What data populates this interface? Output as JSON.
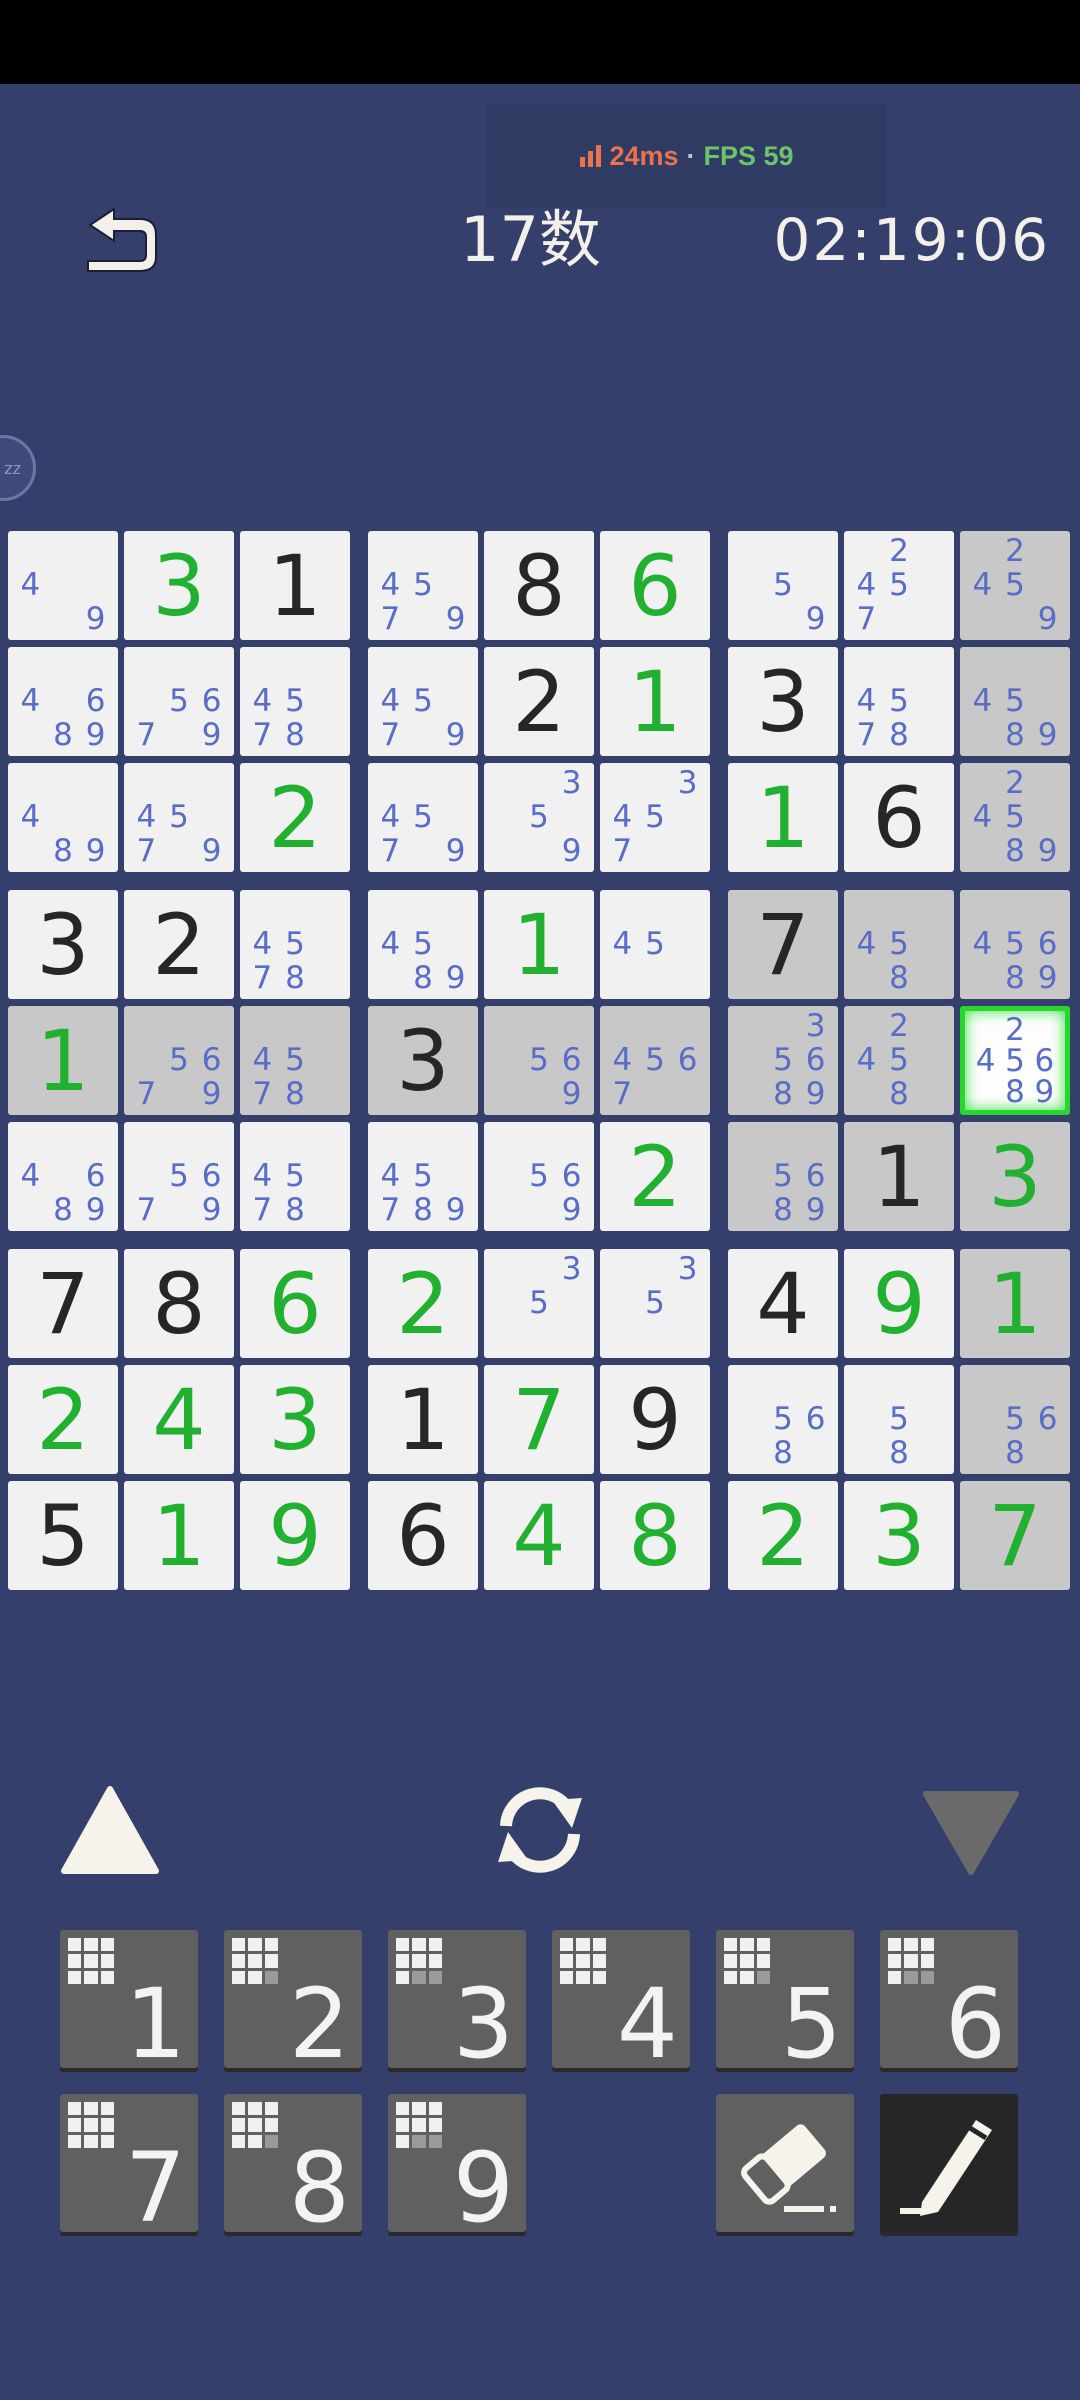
{
  "perf": {
    "latency": "24ms",
    "separator": "·",
    "fps": "FPS 59"
  },
  "header": {
    "level": "17数",
    "timer": "02:19:06"
  },
  "sleep_badge": "zz",
  "colors": {
    "background": "#343f6b",
    "given": "#262626",
    "user_entry": "#22b030",
    "candidate": "#5a6dc6",
    "selected_border": "#29d62e"
  },
  "board": {
    "rows": [
      [
        {
          "c": [
            4,
            9
          ]
        },
        {
          "v": "3",
          "u": true
        },
        {
          "v": "1"
        },
        {
          "c": [
            4,
            5,
            7,
            9
          ]
        },
        {
          "v": "8"
        },
        {
          "v": "6",
          "u": true
        },
        {
          "c": [
            5,
            9
          ]
        },
        {
          "c": [
            2,
            4,
            5,
            7
          ]
        },
        {
          "c": [
            2,
            4,
            5,
            9
          ],
          "s": true
        }
      ],
      [
        {
          "c": [
            4,
            6,
            8,
            9
          ]
        },
        {
          "c": [
            5,
            6,
            7,
            9
          ]
        },
        {
          "c": [
            4,
            5,
            7,
            8
          ]
        },
        {
          "c": [
            4,
            5,
            7,
            9
          ]
        },
        {
          "v": "2"
        },
        {
          "v": "1",
          "u": true
        },
        {
          "v": "3"
        },
        {
          "c": [
            4,
            5,
            7,
            8
          ]
        },
        {
          "c": [
            4,
            5,
            8,
            9
          ],
          "s": true
        }
      ],
      [
        {
          "c": [
            4,
            8,
            9
          ]
        },
        {
          "c": [
            4,
            5,
            7,
            9
          ]
        },
        {
          "v": "2",
          "u": true
        },
        {
          "c": [
            4,
            5,
            7,
            9
          ]
        },
        {
          "c": [
            3,
            5,
            9
          ]
        },
        {
          "c": [
            3,
            4,
            5,
            7
          ]
        },
        {
          "v": "1",
          "u": true
        },
        {
          "v": "6"
        },
        {
          "c": [
            2,
            4,
            5,
            8,
            9
          ],
          "s": true
        }
      ],
      [
        {
          "v": "3"
        },
        {
          "v": "2"
        },
        {
          "c": [
            4,
            5,
            7,
            8
          ]
        },
        {
          "c": [
            4,
            5,
            8,
            9
          ]
        },
        {
          "v": "1",
          "u": true
        },
        {
          "c": [
            4,
            5
          ]
        },
        {
          "v": "7",
          "s": true
        },
        {
          "c": [
            4,
            5,
            8
          ],
          "s": true
        },
        {
          "c": [
            4,
            5,
            6,
            8,
            9
          ],
          "s": true
        }
      ],
      [
        {
          "v": "1",
          "u": true,
          "s": true
        },
        {
          "c": [
            5,
            6,
            7,
            9
          ],
          "s": true
        },
        {
          "c": [
            4,
            5,
            7,
            8
          ],
          "s": true
        },
        {
          "v": "3",
          "s": true
        },
        {
          "c": [
            5,
            6,
            9
          ],
          "s": true
        },
        {
          "c": [
            4,
            5,
            6,
            7
          ],
          "s": true
        },
        {
          "c": [
            3,
            5,
            6,
            8,
            9
          ],
          "s": true
        },
        {
          "c": [
            2,
            4,
            5,
            8
          ],
          "s": true
        },
        {
          "c": [
            2,
            4,
            5,
            6,
            8,
            9
          ],
          "sel": true
        }
      ],
      [
        {
          "c": [
            4,
            6,
            8,
            9
          ]
        },
        {
          "c": [
            5,
            6,
            7,
            9
          ]
        },
        {
          "c": [
            4,
            5,
            7,
            8
          ]
        },
        {
          "c": [
            4,
            5,
            7,
            8,
            9
          ]
        },
        {
          "c": [
            5,
            6,
            9
          ]
        },
        {
          "v": "2",
          "u": true
        },
        {
          "c": [
            5,
            6,
            8,
            9
          ],
          "s": true
        },
        {
          "v": "1",
          "s": true
        },
        {
          "v": "3",
          "u": true,
          "s": true
        }
      ],
      [
        {
          "v": "7"
        },
        {
          "v": "8"
        },
        {
          "v": "6",
          "u": true
        },
        {
          "v": "2",
          "u": true
        },
        {
          "c": [
            3,
            5
          ]
        },
        {
          "c": [
            3,
            5
          ]
        },
        {
          "v": "4"
        },
        {
          "v": "9",
          "u": true
        },
        {
          "v": "1",
          "u": true,
          "s": true
        }
      ],
      [
        {
          "v": "2",
          "u": true
        },
        {
          "v": "4",
          "u": true
        },
        {
          "v": "3",
          "u": true
        },
        {
          "v": "1"
        },
        {
          "v": "7",
          "u": true
        },
        {
          "v": "9"
        },
        {
          "c": [
            5,
            6,
            8
          ]
        },
        {
          "c": [
            5,
            8
          ]
        },
        {
          "c": [
            5,
            6,
            8
          ],
          "s": true
        }
      ],
      [
        {
          "v": "5"
        },
        {
          "v": "1",
          "u": true
        },
        {
          "v": "9",
          "u": true
        },
        {
          "v": "6"
        },
        {
          "v": "4",
          "u": true
        },
        {
          "v": "8",
          "u": true
        },
        {
          "v": "2",
          "u": true
        },
        {
          "v": "3",
          "u": true
        },
        {
          "v": "7",
          "u": true,
          "s": true
        }
      ]
    ]
  },
  "controls": {
    "up_icon": "triangle-up-icon",
    "refresh_icon": "refresh-icon",
    "down_icon": "triangle-down-icon",
    "number_keys": [
      "1",
      "2",
      "3",
      "4",
      "5",
      "6",
      "7",
      "8",
      "9"
    ],
    "erase_icon": "eraser-icon",
    "pencil_icon": "pencil-icon"
  }
}
